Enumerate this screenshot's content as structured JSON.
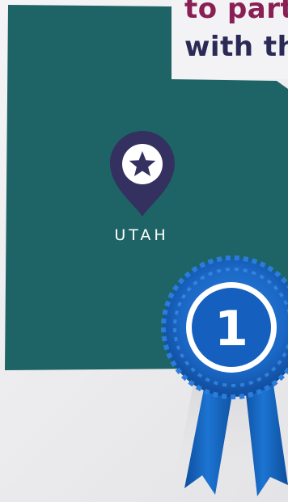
{
  "headline": {
    "line1": "to part",
    "line2": "with th"
  },
  "map": {
    "state_label": "UTAH",
    "state_color": "#1e6466",
    "marker_color": "#34305f",
    "marker_icon": "star-icon"
  },
  "award": {
    "rank": "1",
    "ribbon_color": "#1565c0",
    "icon": "ribbon-award-icon"
  }
}
